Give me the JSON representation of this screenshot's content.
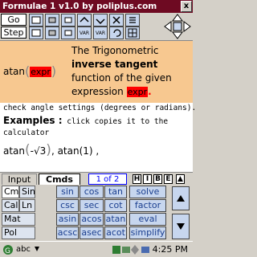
{
  "window": {
    "title": "Formulae 1 v1.0 by poliplus.com",
    "close_label": "x"
  },
  "toolbar": {
    "go_label": "Go",
    "step_label": "Step",
    "var_label": "VAR",
    "icons": [
      "first-page-icon",
      "prev-icon",
      "next-icon",
      "variable-icon",
      "store-icon",
      "clear-icon",
      "menu-icon",
      "list-icon"
    ]
  },
  "description": {
    "func_name": "atan",
    "func_arg": "expr",
    "line1": "The Trigonometric",
    "line2_bold": "inverse tangent",
    "line3": "function of the given",
    "line4_pre": "expression",
    "line4_expr": "expr",
    "line4_post": "."
  },
  "content": {
    "note": "check angle settings (degrees or radians).",
    "examples_heading": "Examples :",
    "examples_text": " click copies it to the calculator",
    "example1_func": "atan",
    "example1_arg": "-√3",
    "example2": ", atan(1) ,"
  },
  "tabs": {
    "input_label": "Input",
    "cmds_label": "Cmds",
    "page_indicator": "1 of 2",
    "nav_buttons": [
      "H",
      "I",
      "B",
      "E"
    ]
  },
  "keypad": {
    "categories": [
      "Cmd",
      "Cal",
      "Mat",
      "Pol"
    ],
    "categories_right": [
      "Sin",
      "Ln",
      "",
      ""
    ],
    "rows": [
      [
        "sin",
        "cos",
        "tan",
        "solve"
      ],
      [
        "csc",
        "sec",
        "cot",
        "factor"
      ],
      [
        "asin",
        "acos",
        "atan",
        "eval"
      ],
      [
        "acsc",
        "asec",
        "acot",
        "simplify"
      ]
    ]
  },
  "taskbar": {
    "input_label": "abc",
    "time": "4:25 PM"
  },
  "colors": {
    "title_bar": "#6e0a22",
    "desc_bg": "#f7c890",
    "expr_highlight": "#ff0000",
    "key_bg": "#c7d6ee",
    "key_text": "#1b3f8f"
  }
}
